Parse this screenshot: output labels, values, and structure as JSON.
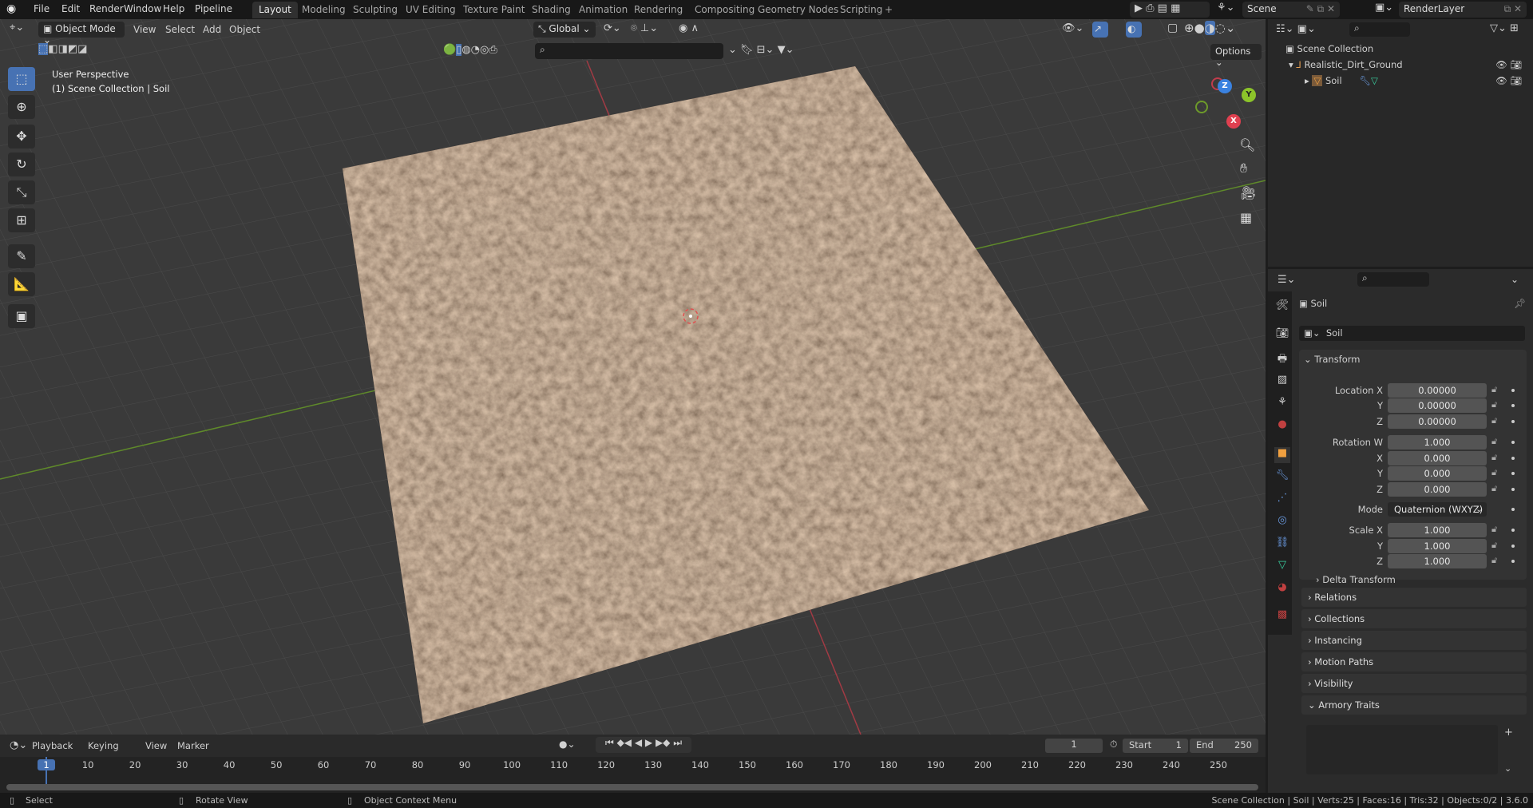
{
  "menu": [
    "File",
    "Edit",
    "Render",
    "Window",
    "Help",
    "Pipeline"
  ],
  "workspaces": [
    "Layout",
    "Modeling",
    "Sculpting",
    "UV Editing",
    "Texture Paint",
    "Shading",
    "Animation",
    "Rendering",
    "Compositing",
    "Geometry Nodes",
    "Scripting"
  ],
  "add_workspace": "+",
  "scene": "Scene",
  "render_layer": "RenderLayer",
  "viewport": {
    "mode": "Object Mode",
    "menus": [
      "View",
      "Select",
      "Add",
      "Object"
    ],
    "orientation": "Global",
    "options": "Options",
    "perspective": "User Perspective",
    "context": "(1) Scene Collection | Soil",
    "gizmo": {
      "x": "X",
      "y": "Y",
      "z": "Z"
    }
  },
  "outliner": {
    "root": "Scene Collection",
    "items": [
      {
        "name": "Realistic_Dirt_Ground",
        "type": "empty"
      },
      {
        "name": "Soil",
        "type": "mesh"
      }
    ]
  },
  "properties": {
    "object_name": "Soil",
    "name_field": "Soil",
    "transform_title": "Transform",
    "rows": [
      {
        "label": "Location X",
        "value": "0.00000"
      },
      {
        "label": "Y",
        "value": "0.00000"
      },
      {
        "label": "Z",
        "value": "0.00000"
      },
      {
        "label": "Rotation W",
        "value": "1.000"
      },
      {
        "label": "X",
        "value": "0.000"
      },
      {
        "label": "Y",
        "value": "0.000"
      },
      {
        "label": "Z",
        "value": "0.000"
      },
      {
        "label": "Mode",
        "value": "Quaternion (WXYZ)"
      },
      {
        "label": "Scale X",
        "value": "1.000"
      },
      {
        "label": "Y",
        "value": "1.000"
      },
      {
        "label": "Z",
        "value": "1.000"
      }
    ],
    "delta": "Delta Transform",
    "panels": [
      "Relations",
      "Collections",
      "Instancing",
      "Motion Paths",
      "Visibility",
      "Armory Traits"
    ]
  },
  "timeline": {
    "menus": [
      "Playback",
      "Keying",
      "View",
      "Marker"
    ],
    "current_frame": "1",
    "start_label": "Start",
    "start": "1",
    "end_label": "End",
    "end": "250",
    "ticks": [
      "1",
      "10",
      "20",
      "30",
      "40",
      "50",
      "60",
      "70",
      "80",
      "90",
      "100",
      "110",
      "120",
      "130",
      "140",
      "150",
      "160",
      "170",
      "180",
      "190",
      "200",
      "210",
      "220",
      "230",
      "240",
      "250"
    ]
  },
  "status": {
    "select": "Select",
    "rotate": "Rotate View",
    "context_menu": "Object Context Menu",
    "stats": "Scene Collection | Soil | Verts:25 | Faces:16 | Tris:32 | Objects:0/2 | 3.6.0"
  },
  "colors": {
    "accent": "#4772b3",
    "x_axis": "#e04050",
    "y_axis": "#8cc42a",
    "z_axis": "#3a82e0"
  }
}
